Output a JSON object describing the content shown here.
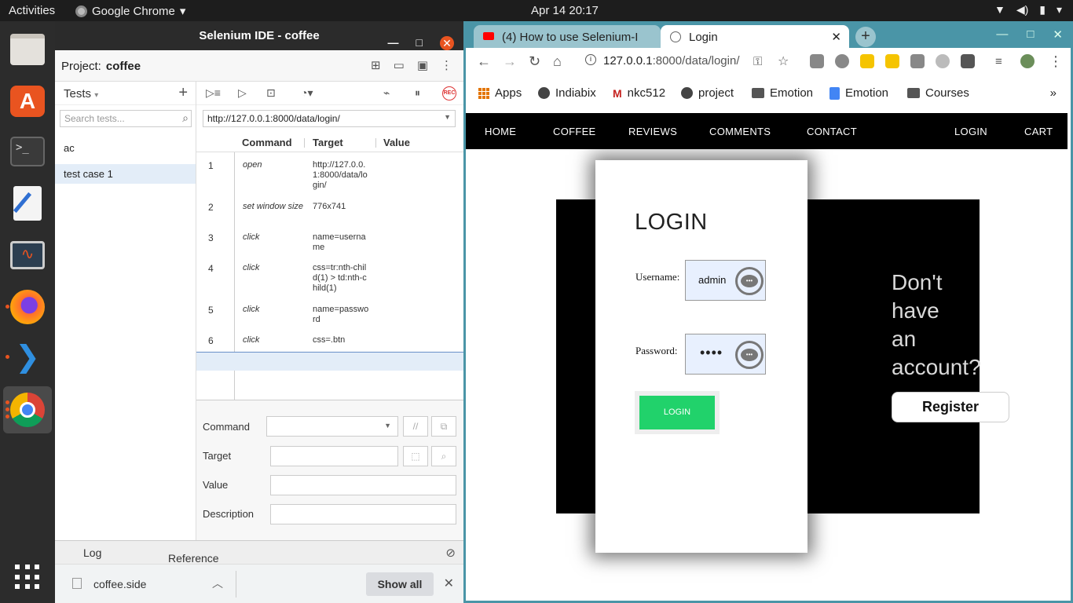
{
  "topbar": {
    "activities": "Activities",
    "app": "Google Chrome",
    "clock": "Apr 14  20:17"
  },
  "ide": {
    "title": "Selenium IDE - coffee",
    "project_label": "Project:",
    "project_name": "coffee",
    "tests_label": "Tests",
    "search_placeholder": "Search tests...",
    "tests": [
      "ac",
      "test case 1"
    ],
    "url": "http://127.0.0.1:8000/data/login/",
    "columns": {
      "command": "Command",
      "target": "Target",
      "value": "Value"
    },
    "commands": [
      {
        "n": "1",
        "command": "open",
        "target": "http://127.0.0.1:8000/data/login/"
      },
      {
        "n": "2",
        "command": "set window size",
        "target": "776x741"
      },
      {
        "n": "3",
        "command": "click",
        "target": "name=username"
      },
      {
        "n": "4",
        "command": "click",
        "target": "css=tr:nth-child(1) > td:nth-child(1)"
      },
      {
        "n": "5",
        "command": "click",
        "target": "name=password"
      },
      {
        "n": "6",
        "command": "click",
        "target": "css=.btn"
      }
    ],
    "form": {
      "command": "Command",
      "target": "Target",
      "value": "Value",
      "description": "Description"
    },
    "rec": "REC",
    "log_tab": "Log",
    "reference_tab": "Reference"
  },
  "downloads": {
    "file": "coffee.side",
    "show_all": "Show all"
  },
  "chrome": {
    "tab1": "(4) How to use Selenium-I",
    "tab2": "Login",
    "url_host": "127.0.0.1",
    "url_rest": ":8000/data/login/",
    "bookmarks": [
      "Apps",
      "Indiabix",
      "nkc512",
      "project",
      "Emotion",
      "Emotion",
      "Courses"
    ]
  },
  "site": {
    "nav": [
      "HOME",
      "COFFEE",
      "REVIEWS",
      "COMMENTS",
      "CONTACT",
      "LOGIN",
      "CART"
    ],
    "login_title": "LOGIN",
    "username_label": "Username:",
    "username_value": "admin",
    "password_label": "Password:",
    "password_value": "••••",
    "login_button": "LOGIN",
    "dont_have": [
      "Don't",
      "have",
      "an",
      "account?"
    ],
    "register": "Register"
  }
}
